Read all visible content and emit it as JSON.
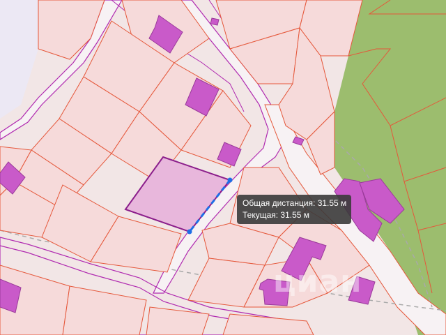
{
  "map": {
    "colors": {
      "background_land": "#f2e6e6",
      "parcel_fill": "#f6dada",
      "parcel_border": "#e5573a",
      "road_fill": "#f7f2f4",
      "road_border": "#b02ab0",
      "building_fill": "#c95ac9",
      "building_border": "#9a3a9a",
      "forest_fill": "#9cbd6e",
      "water_fill": "#ece8f4",
      "selected_fill": "#e8b7dc",
      "selected_border": "#8b1e8b",
      "measure_line": "#1e6fe6",
      "yellow_area": "#f6eaa8"
    },
    "icons": [
      "measure-line-icon",
      "vertex-handle-icon"
    ]
  },
  "tooltip": {
    "total_distance_label": "Общая дистанция: 31.55 м",
    "current_distance_label": "Текущая: 31.55 м"
  },
  "watermark": {
    "text": "циан"
  }
}
